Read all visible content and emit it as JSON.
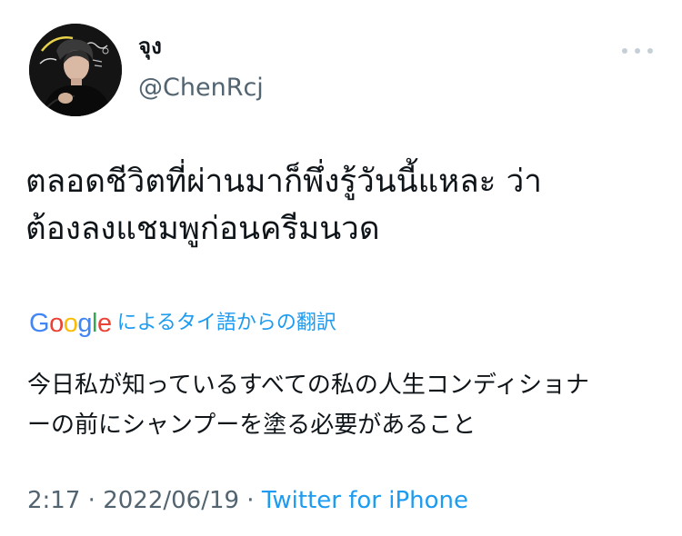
{
  "author": {
    "display_name": "จุง",
    "handle": "@ChenRcj"
  },
  "icons": {
    "avatar": "profile-photo",
    "more": "more-horizontal-icon"
  },
  "tweet": {
    "text_lines": [
      "ตลอดชีวิตที่ผ่านมาก็พึ่งรู้วันนี้แหละ ว่า",
      "ต้องลงแชมพูก่อนครีมนวด"
    ]
  },
  "translation": {
    "logo_letters": [
      "G",
      "o",
      "o",
      "g",
      "l",
      "e"
    ],
    "logo_colors": [
      "#4285F4",
      "#EA4335",
      "#FBBC05",
      "#4285F4",
      "#34A853",
      "#EA4335"
    ],
    "label": "によるタイ語からの翻訳",
    "text_lines": [
      "今日私が知っているすべての私の人生コンディショナ",
      "ーの前にシャンプーを塗る必要があること"
    ]
  },
  "meta": {
    "time": "2:17",
    "separator": " · ",
    "date": "2022/06/19",
    "source": "Twitter for iPhone"
  },
  "colors": {
    "text_primary": "#0f1419",
    "text_secondary": "#536471",
    "accent": "#1d9bf0"
  }
}
